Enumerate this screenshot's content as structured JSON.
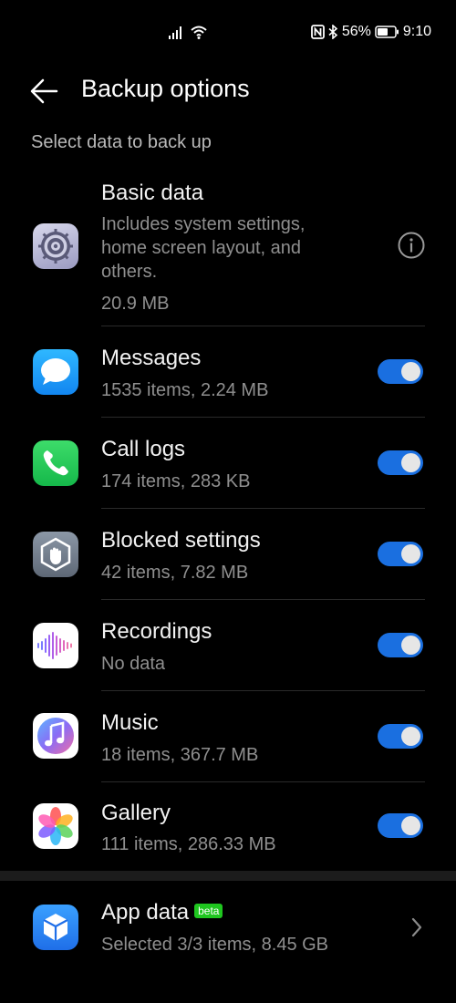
{
  "status_bar": {
    "battery": "56%",
    "time": "9:10"
  },
  "header": {
    "title": "Backup options"
  },
  "section_label": "Select data to back up",
  "items": [
    {
      "name": "Basic data",
      "desc_lines": [
        "Includes system settings,",
        "home screen layout, and",
        "others."
      ],
      "size": "20.9 MB",
      "icon": "settings-gear-icon",
      "control": "info"
    },
    {
      "name": "Messages",
      "details": "1535 items, 2.24 MB",
      "icon": "messages-icon",
      "control": "toggle",
      "enabled": true
    },
    {
      "name": "Call logs",
      "details": "174 items, 283 KB",
      "icon": "phone-icon",
      "control": "toggle",
      "enabled": true
    },
    {
      "name": "Blocked settings",
      "details": "42 items, 7.82 MB",
      "icon": "block-hand-icon",
      "control": "toggle",
      "enabled": true
    },
    {
      "name": "Recordings",
      "details": "No data",
      "icon": "recorder-waveform-icon",
      "control": "toggle",
      "enabled": true
    },
    {
      "name": "Music",
      "details": "18 items, 367.7 MB",
      "icon": "music-note-icon",
      "control": "toggle",
      "enabled": true
    },
    {
      "name": "Gallery",
      "details": "111 items, 286.33 MB",
      "icon": "gallery-flower-icon",
      "control": "toggle",
      "enabled": true
    }
  ],
  "app_data": {
    "name": "App data",
    "badge": "beta",
    "details": "Selected 3/3 items, 8.45 GB",
    "icon": "app-cube-icon"
  },
  "colors": {
    "toggle_on": "#1a6fe0",
    "badge_green": "#1fc61f"
  }
}
